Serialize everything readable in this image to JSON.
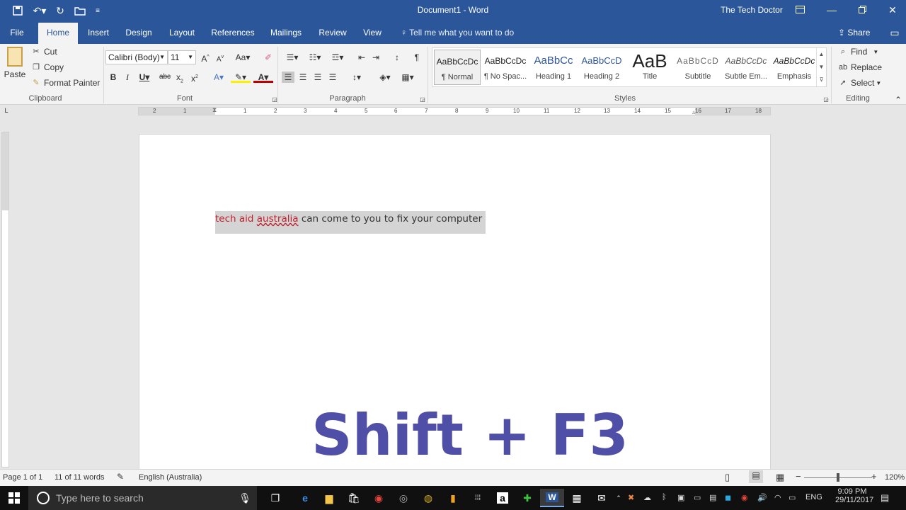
{
  "titlebar": {
    "title": "Document1  -  Word",
    "user": "The Tech Doctor"
  },
  "tabs": [
    {
      "label": "File"
    },
    {
      "label": "Home"
    },
    {
      "label": "Insert"
    },
    {
      "label": "Design"
    },
    {
      "label": "Layout"
    },
    {
      "label": "References"
    },
    {
      "label": "Mailings"
    },
    {
      "label": "Review"
    },
    {
      "label": "View"
    }
  ],
  "tellme": "Tell me what you want to do",
  "share": "Share",
  "clipboard": {
    "paste": "Paste",
    "cut": "Cut",
    "copy": "Copy",
    "format_painter": "Format Painter",
    "label": "Clipboard"
  },
  "font": {
    "name": "Calibri (Body)",
    "size": "11",
    "label": "Font"
  },
  "paragraph": {
    "label": "Paragraph"
  },
  "styles": {
    "label": "Styles",
    "items": [
      {
        "preview": "AaBbCcDc",
        "name": "¶ Normal"
      },
      {
        "preview": "AaBbCcDc",
        "name": "¶ No Spac..."
      },
      {
        "preview": "AaBbCc",
        "name": "Heading 1"
      },
      {
        "preview": "AaBbCcD",
        "name": "Heading 2"
      },
      {
        "preview": "AaB",
        "name": "Title"
      },
      {
        "preview": "AaBbCcD",
        "name": "Subtitle"
      },
      {
        "preview": "AaBbCcDc",
        "name": "Subtle Em..."
      },
      {
        "preview": "AaBbCcDc",
        "name": "Emphasis"
      }
    ]
  },
  "editing": {
    "find": "Find",
    "replace": "Replace",
    "select": "Select",
    "label": "Editing"
  },
  "document": {
    "text_part1": "tech aid ",
    "text_part2": "australia",
    "text_part3": " can come to you to fix your computer",
    "overlay": "Shift + F3"
  },
  "status": {
    "page": "Page 1 of 1",
    "words": "11 of 11 words",
    "language": "English (Australia)",
    "zoom": "120%"
  },
  "taskbar": {
    "search_placeholder": "Type here to search",
    "lang": "ENG",
    "time": "9:09 PM",
    "date": "29/11/2017"
  },
  "colors": {
    "accent": "#2b579a",
    "misspelled": "#c5202c",
    "overlay": "#4f4fa8"
  }
}
